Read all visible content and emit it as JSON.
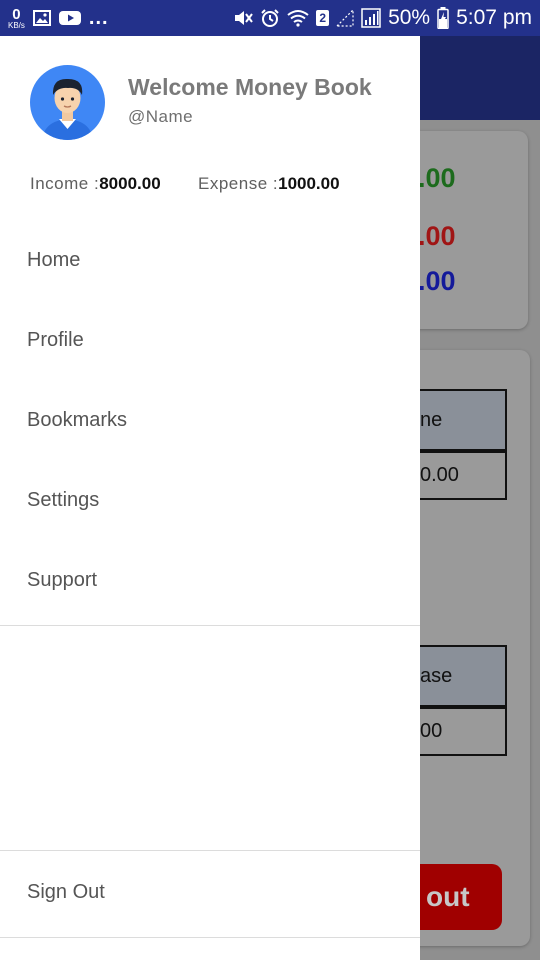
{
  "status_bar": {
    "net_speed_value": "0",
    "net_speed_unit": "KB/s",
    "more_indicator": "...",
    "sim_badge": "2",
    "battery_percent": "50%",
    "time": "5:07 pm"
  },
  "drawer": {
    "header": {
      "title": "Welcome Money Book",
      "handle": "@Name"
    },
    "stats": {
      "income_label": "Income :",
      "income_value": "8000.00",
      "expense_label": "Expense :",
      "expense_value": "1000.00"
    },
    "menu": [
      {
        "label": "Home"
      },
      {
        "label": "Profile"
      },
      {
        "label": "Bookmarks"
      },
      {
        "label": "Settings"
      },
      {
        "label": "Support"
      }
    ],
    "sign_out_label": "Sign Out"
  },
  "background_app": {
    "summary_values": [
      ".00",
      ".00",
      ".00"
    ],
    "summary_colors": [
      "#1d6b1d",
      "#a01515",
      "#141a9a"
    ],
    "income_table": {
      "header": "ne",
      "value": "0.00"
    },
    "expense_table": {
      "header": "ase",
      "value": "00"
    },
    "action_button_label": "out"
  },
  "colors": {
    "status_bar": "#23318b",
    "app_toolbar": "#1b2564",
    "scrim_button": "#a00000"
  }
}
